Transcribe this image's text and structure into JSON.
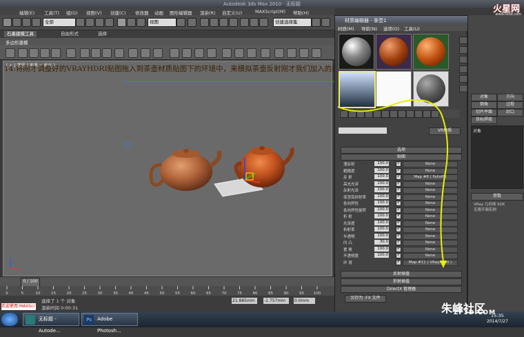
{
  "window": {
    "title": "Autodesk 3ds Max 2010 · 无标题",
    "controls": [
      "—",
      "□",
      "✕"
    ]
  },
  "menu": {
    "items": [
      "编辑(E)",
      "工具(T)",
      "组(G)",
      "视图(V)",
      "创建(C)",
      "修改器",
      "动画",
      "图形编辑器",
      "渲染(R)",
      "自定义(U)",
      "MAXScript(M)",
      "帮助(H)"
    ]
  },
  "toolbar": {
    "selection_filter": "全部",
    "ref_coord": "视图",
    "named_selection": "创建选择集"
  },
  "ribbon": {
    "tabs": [
      "石墨建模工具",
      "自由形式",
      "选择"
    ],
    "active_tab": "石墨建模工具",
    "panel_label": "多边形建模"
  },
  "viewport": {
    "label": "[ + ] 透视 ] 平滑 + 高光 ]",
    "instruction": "14:将刚才调整好的VRAYHDRI贴图拖入到茶壶材质贴图下的环境中，来模拟茶壶反射刚才我们加入的贴图"
  },
  "material_editor": {
    "title": "材质编辑器 - 茶壶1",
    "menu": [
      "材质(M)",
      "导航(N)",
      "选项(O)",
      "工具(U)"
    ],
    "material_type": "VR材质",
    "rollouts": {
      "top": "选项",
      "maps": "贴图",
      "reflect_interp": "反射插值",
      "refract_interp": "折射插值",
      "directx": "DirectX 管理器",
      "save_fx": "另存为 .FX 文件"
    },
    "map_rows": [
      {
        "label": "漫反射",
        "value": "100.0",
        "map": "None"
      },
      {
        "label": "粗糙度",
        "value": "100.0",
        "map": "None"
      },
      {
        "label": "反 射",
        "value": "100.0",
        "map": "Map #8 ( Falloff )"
      },
      {
        "label": "高光光泽",
        "value": "100.0",
        "map": "None"
      },
      {
        "label": "反射光泽",
        "value": "100.0",
        "map": "None"
      },
      {
        "label": "菲涅耳折射率",
        "value": "100.0",
        "map": "None"
      },
      {
        "label": "各向异性",
        "value": "100.0",
        "map": "None"
      },
      {
        "label": "各向异性旋转",
        "value": "100.0",
        "map": "None"
      },
      {
        "label": "折 射",
        "value": "100.0",
        "map": "None"
      },
      {
        "label": "光泽度",
        "value": "100.0",
        "map": "None"
      },
      {
        "label": "折射率",
        "value": "100.0",
        "map": "None"
      },
      {
        "label": "半透明",
        "value": "100.0",
        "map": "None"
      },
      {
        "label": "凹 凸",
        "value": "30.0",
        "map": "None"
      },
      {
        "label": "置 换",
        "value": "100.0",
        "map": "None"
      },
      {
        "label": "不透明度",
        "value": "100.0",
        "map": "None"
      },
      {
        "label": "环 境",
        "value": "",
        "map": "Map #11 ( VRayHDRI )"
      }
    ]
  },
  "command_panel": {
    "buttons": [
      "对象",
      "方向",
      "倒角",
      "过程",
      "切片平面",
      "封口",
      "目标焊接",
      "对象"
    ],
    "bottom_title": "参数",
    "bottom_lines": [
      "VRay 几何体 SDK",
      "无限平面实例"
    ]
  },
  "timeline": {
    "frame_display": "0 / 100",
    "ticks": [
      "0",
      "5",
      "10",
      "15",
      "20",
      "25",
      "30",
      "35",
      "40",
      "45",
      "50",
      "55",
      "60",
      "65",
      "70",
      "75",
      "80",
      "85",
      "90",
      "95",
      "100"
    ]
  },
  "status": {
    "welcome": "欢迎使用 MAXScr",
    "selection": "选择了 1 个 对象",
    "render_time": "渲染时间 0:00:31",
    "x": "21.885mm",
    "y": "-1.757mm",
    "z": "0.0mm"
  },
  "taskbar": {
    "apps": [
      "无标题 - Autode...",
      "Adobe Photosh..."
    ],
    "clock_time": "15:35",
    "clock_date": "2014/7/27"
  },
  "watermarks": {
    "top_right": "火星网",
    "top_right_url": "www.hxsd.com",
    "bottom_right": "朱峰社区",
    "bottom_right_url": "ZF3D.COM"
  }
}
